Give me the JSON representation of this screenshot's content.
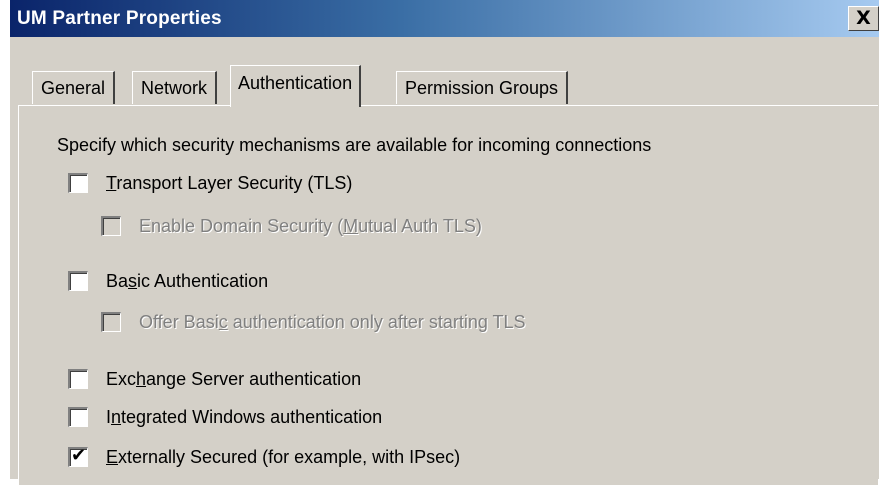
{
  "window": {
    "title": "UM Partner Properties",
    "close_glyph": "X"
  },
  "tabs": [
    {
      "label": "General"
    },
    {
      "label": "Network"
    },
    {
      "label": "Authentication",
      "active": true
    },
    {
      "label": "Permission Groups"
    }
  ],
  "panel": {
    "description": "Specify which security mechanisms are available for incoming connections",
    "options": [
      {
        "pre": "",
        "key": "T",
        "post": "ransport Layer Security (TLS)",
        "checked": false,
        "enabled": true
      },
      {
        "pre": "Enable Domain Security (",
        "key": "M",
        "post": "utual Auth TLS)",
        "checked": false,
        "enabled": false
      },
      {
        "pre": "Ba",
        "key": "s",
        "post": "ic Authentication",
        "checked": false,
        "enabled": true
      },
      {
        "pre": "Offer Basi",
        "key": "c",
        "post": " authentication only after starting TLS",
        "checked": false,
        "enabled": false
      },
      {
        "pre": "Exc",
        "key": "h",
        "post": "ange Server authentication",
        "checked": false,
        "enabled": true
      },
      {
        "pre": "I",
        "key": "n",
        "post": "tegrated Windows authentication",
        "checked": false,
        "enabled": true
      },
      {
        "pre": "",
        "key": "E",
        "post": "xternally Secured (for example, with IPsec)",
        "checked": true,
        "enabled": true
      }
    ]
  }
}
